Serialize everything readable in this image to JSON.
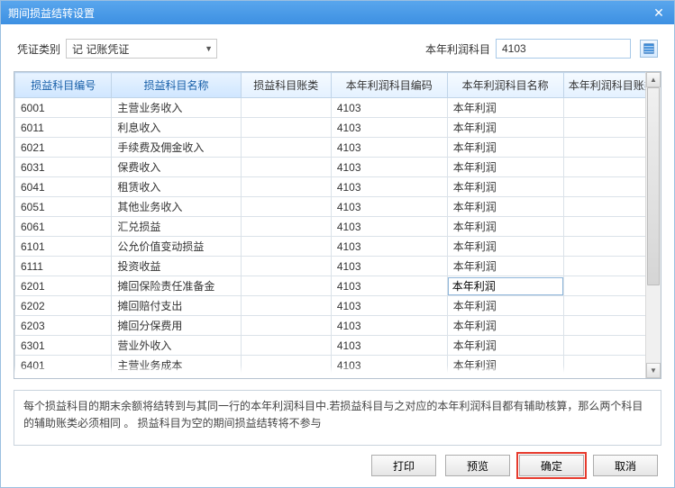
{
  "window": {
    "title": "期间损益结转设置"
  },
  "header": {
    "voucher_type_label": "凭证类别",
    "voucher_type_value": "记 记账凭证",
    "profit_account_label": "本年利润科目",
    "profit_account_value": "4103"
  },
  "columns": [
    "损益科目编号",
    "损益科目名称",
    "损益科目账类",
    "本年利润科目编码",
    "本年利润科目名称",
    "本年利润科目账类"
  ],
  "sorted_columns": [
    0,
    1
  ],
  "editing_row": 9,
  "rows": [
    {
      "code": "6001",
      "name": "主营业务收入",
      "acct": "",
      "pcode": "4103",
      "pname": "本年利润",
      "pacct": ""
    },
    {
      "code": "6011",
      "name": "利息收入",
      "acct": "",
      "pcode": "4103",
      "pname": "本年利润",
      "pacct": ""
    },
    {
      "code": "6021",
      "name": "手续费及佣金收入",
      "acct": "",
      "pcode": "4103",
      "pname": "本年利润",
      "pacct": ""
    },
    {
      "code": "6031",
      "name": "保费收入",
      "acct": "",
      "pcode": "4103",
      "pname": "本年利润",
      "pacct": ""
    },
    {
      "code": "6041",
      "name": "租赁收入",
      "acct": "",
      "pcode": "4103",
      "pname": "本年利润",
      "pacct": ""
    },
    {
      "code": "6051",
      "name": "其他业务收入",
      "acct": "",
      "pcode": "4103",
      "pname": "本年利润",
      "pacct": ""
    },
    {
      "code": "6061",
      "name": "汇兑损益",
      "acct": "",
      "pcode": "4103",
      "pname": "本年利润",
      "pacct": ""
    },
    {
      "code": "6101",
      "name": "公允价值变动损益",
      "acct": "",
      "pcode": "4103",
      "pname": "本年利润",
      "pacct": ""
    },
    {
      "code": "6111",
      "name": "投资收益",
      "acct": "",
      "pcode": "4103",
      "pname": "本年利润",
      "pacct": ""
    },
    {
      "code": "6201",
      "name": "摊回保险责任准备金",
      "acct": "",
      "pcode": "4103",
      "pname": "本年利润",
      "pacct": ""
    },
    {
      "code": "6202",
      "name": "摊回赔付支出",
      "acct": "",
      "pcode": "4103",
      "pname": "本年利润",
      "pacct": ""
    },
    {
      "code": "6203",
      "name": "摊回分保费用",
      "acct": "",
      "pcode": "4103",
      "pname": "本年利润",
      "pacct": ""
    },
    {
      "code": "6301",
      "name": "营业外收入",
      "acct": "",
      "pcode": "4103",
      "pname": "本年利润",
      "pacct": ""
    },
    {
      "code": "6401",
      "name": "主营业务成本",
      "acct": "",
      "pcode": "4103",
      "pname": "本年利润",
      "pacct": ""
    }
  ],
  "note": "每个损益科目的期末余额将结转到与其同一行的本年利润科目中.若损益科目与之对应的本年利润科目都有辅助核算，那么两个科目的辅助账类必须相同 。 损益科目为空的期间损益结转将不参与",
  "buttons": {
    "print": "打印",
    "preview": "预览",
    "ok": "确定",
    "cancel": "取消"
  }
}
